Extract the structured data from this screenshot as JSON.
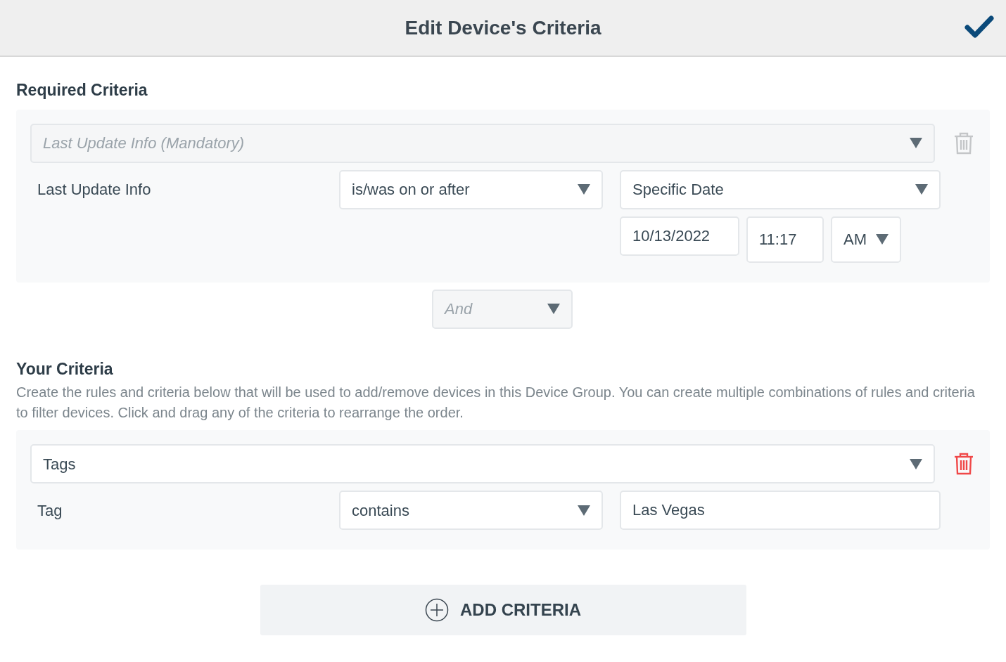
{
  "header": {
    "title": "Edit Device's Criteria"
  },
  "required": {
    "heading": "Required Criteria",
    "criteria": [
      {
        "type": {
          "placeholder": "Last Update Info (Mandatory)",
          "disabled": true
        },
        "delete_disabled": true,
        "label": "Last Update Info",
        "operator": "is/was on or after",
        "fields": [
          {
            "kind": "select",
            "value": "Specific Date"
          },
          {
            "kind": "text",
            "value": "10/13/2022"
          },
          {
            "kind": "text",
            "value": "11:17"
          },
          {
            "kind": "select",
            "value": "AM"
          }
        ]
      }
    ]
  },
  "connector": {
    "value": "And",
    "disabled": true
  },
  "yours": {
    "heading": "Your Criteria",
    "description": "Create the rules and criteria below that will be used to add/remove devices in this Device Group. You can create multiple combinations of rules and criteria to filter devices. Click and drag any of the criteria to rearrange the order.",
    "criteria": [
      {
        "type": {
          "value": "Tags",
          "disabled": false
        },
        "delete_disabled": false,
        "label": "Tag",
        "operator": "contains",
        "fields": [
          {
            "kind": "text",
            "value": "Las Vegas"
          }
        ]
      }
    ]
  },
  "add_button": {
    "label": "ADD CRITERIA"
  }
}
